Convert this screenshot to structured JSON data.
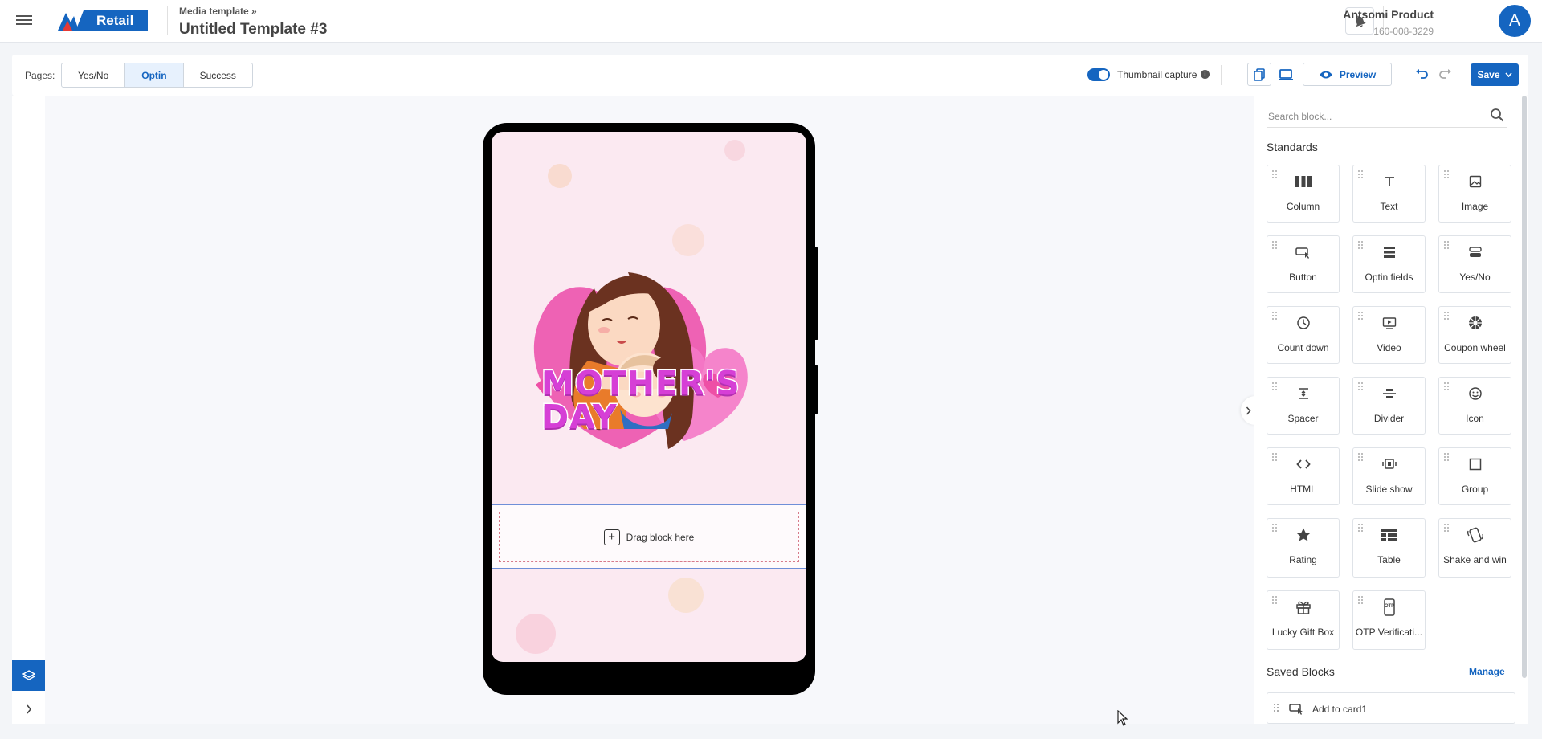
{
  "header": {
    "brand": "Retail",
    "breadcrumb": "Media template »",
    "title": "Untitled Template #3",
    "account_name": "Antsomi Product",
    "account_id": "160-008-3229",
    "avatar_letter": "A"
  },
  "toolbar": {
    "pages_label": "Pages:",
    "pages": [
      "Yes/No",
      "Optin",
      "Success"
    ],
    "active_page": "Optin",
    "thumbnail_label": "Thumbnail capture",
    "thumbnail_on": true,
    "preview_label": "Preview",
    "save_label": "Save"
  },
  "canvas": {
    "device": "mobile",
    "drop_label": "Drag block here",
    "artwork": "mother-and-baby-hug illustration",
    "artwork_text_line1": "MOTHER'S",
    "artwork_text_line2": "DAY"
  },
  "panel": {
    "search_placeholder": "Search block...",
    "standards_title": "Standards",
    "blocks": [
      {
        "label": "Column",
        "icon": "column-icon"
      },
      {
        "label": "Text",
        "icon": "text-icon"
      },
      {
        "label": "Image",
        "icon": "image-icon"
      },
      {
        "label": "Button",
        "icon": "button-icon"
      },
      {
        "label": "Optin fields",
        "icon": "optin-fields-icon"
      },
      {
        "label": "Yes/No",
        "icon": "yes-no-icon"
      },
      {
        "label": "Count down",
        "icon": "clock-icon"
      },
      {
        "label": "Video",
        "icon": "video-icon"
      },
      {
        "label": "Coupon wheel",
        "icon": "coupon-wheel-icon"
      },
      {
        "label": "Spacer",
        "icon": "spacer-icon"
      },
      {
        "label": "Divider",
        "icon": "divider-icon"
      },
      {
        "label": "Icon",
        "icon": "smiley-icon"
      },
      {
        "label": "HTML",
        "icon": "code-icon"
      },
      {
        "label": "Slide show",
        "icon": "slideshow-icon"
      },
      {
        "label": "Group",
        "icon": "group-icon"
      },
      {
        "label": "Rating",
        "icon": "star-icon"
      },
      {
        "label": "Table",
        "icon": "table-icon"
      },
      {
        "label": "Shake and win",
        "icon": "shake-icon"
      },
      {
        "label": "Lucky Gift Box",
        "icon": "gift-icon"
      },
      {
        "label": "OTP Verificati...",
        "icon": "otp-icon"
      }
    ],
    "saved_title": "Saved Blocks",
    "manage_label": "Manage",
    "saved_blocks": [
      "Add to card1"
    ]
  },
  "colors": {
    "accent": "#1565c0",
    "screen_bg": "#fbe9f1",
    "heading_magenta": "#d63fd6"
  }
}
